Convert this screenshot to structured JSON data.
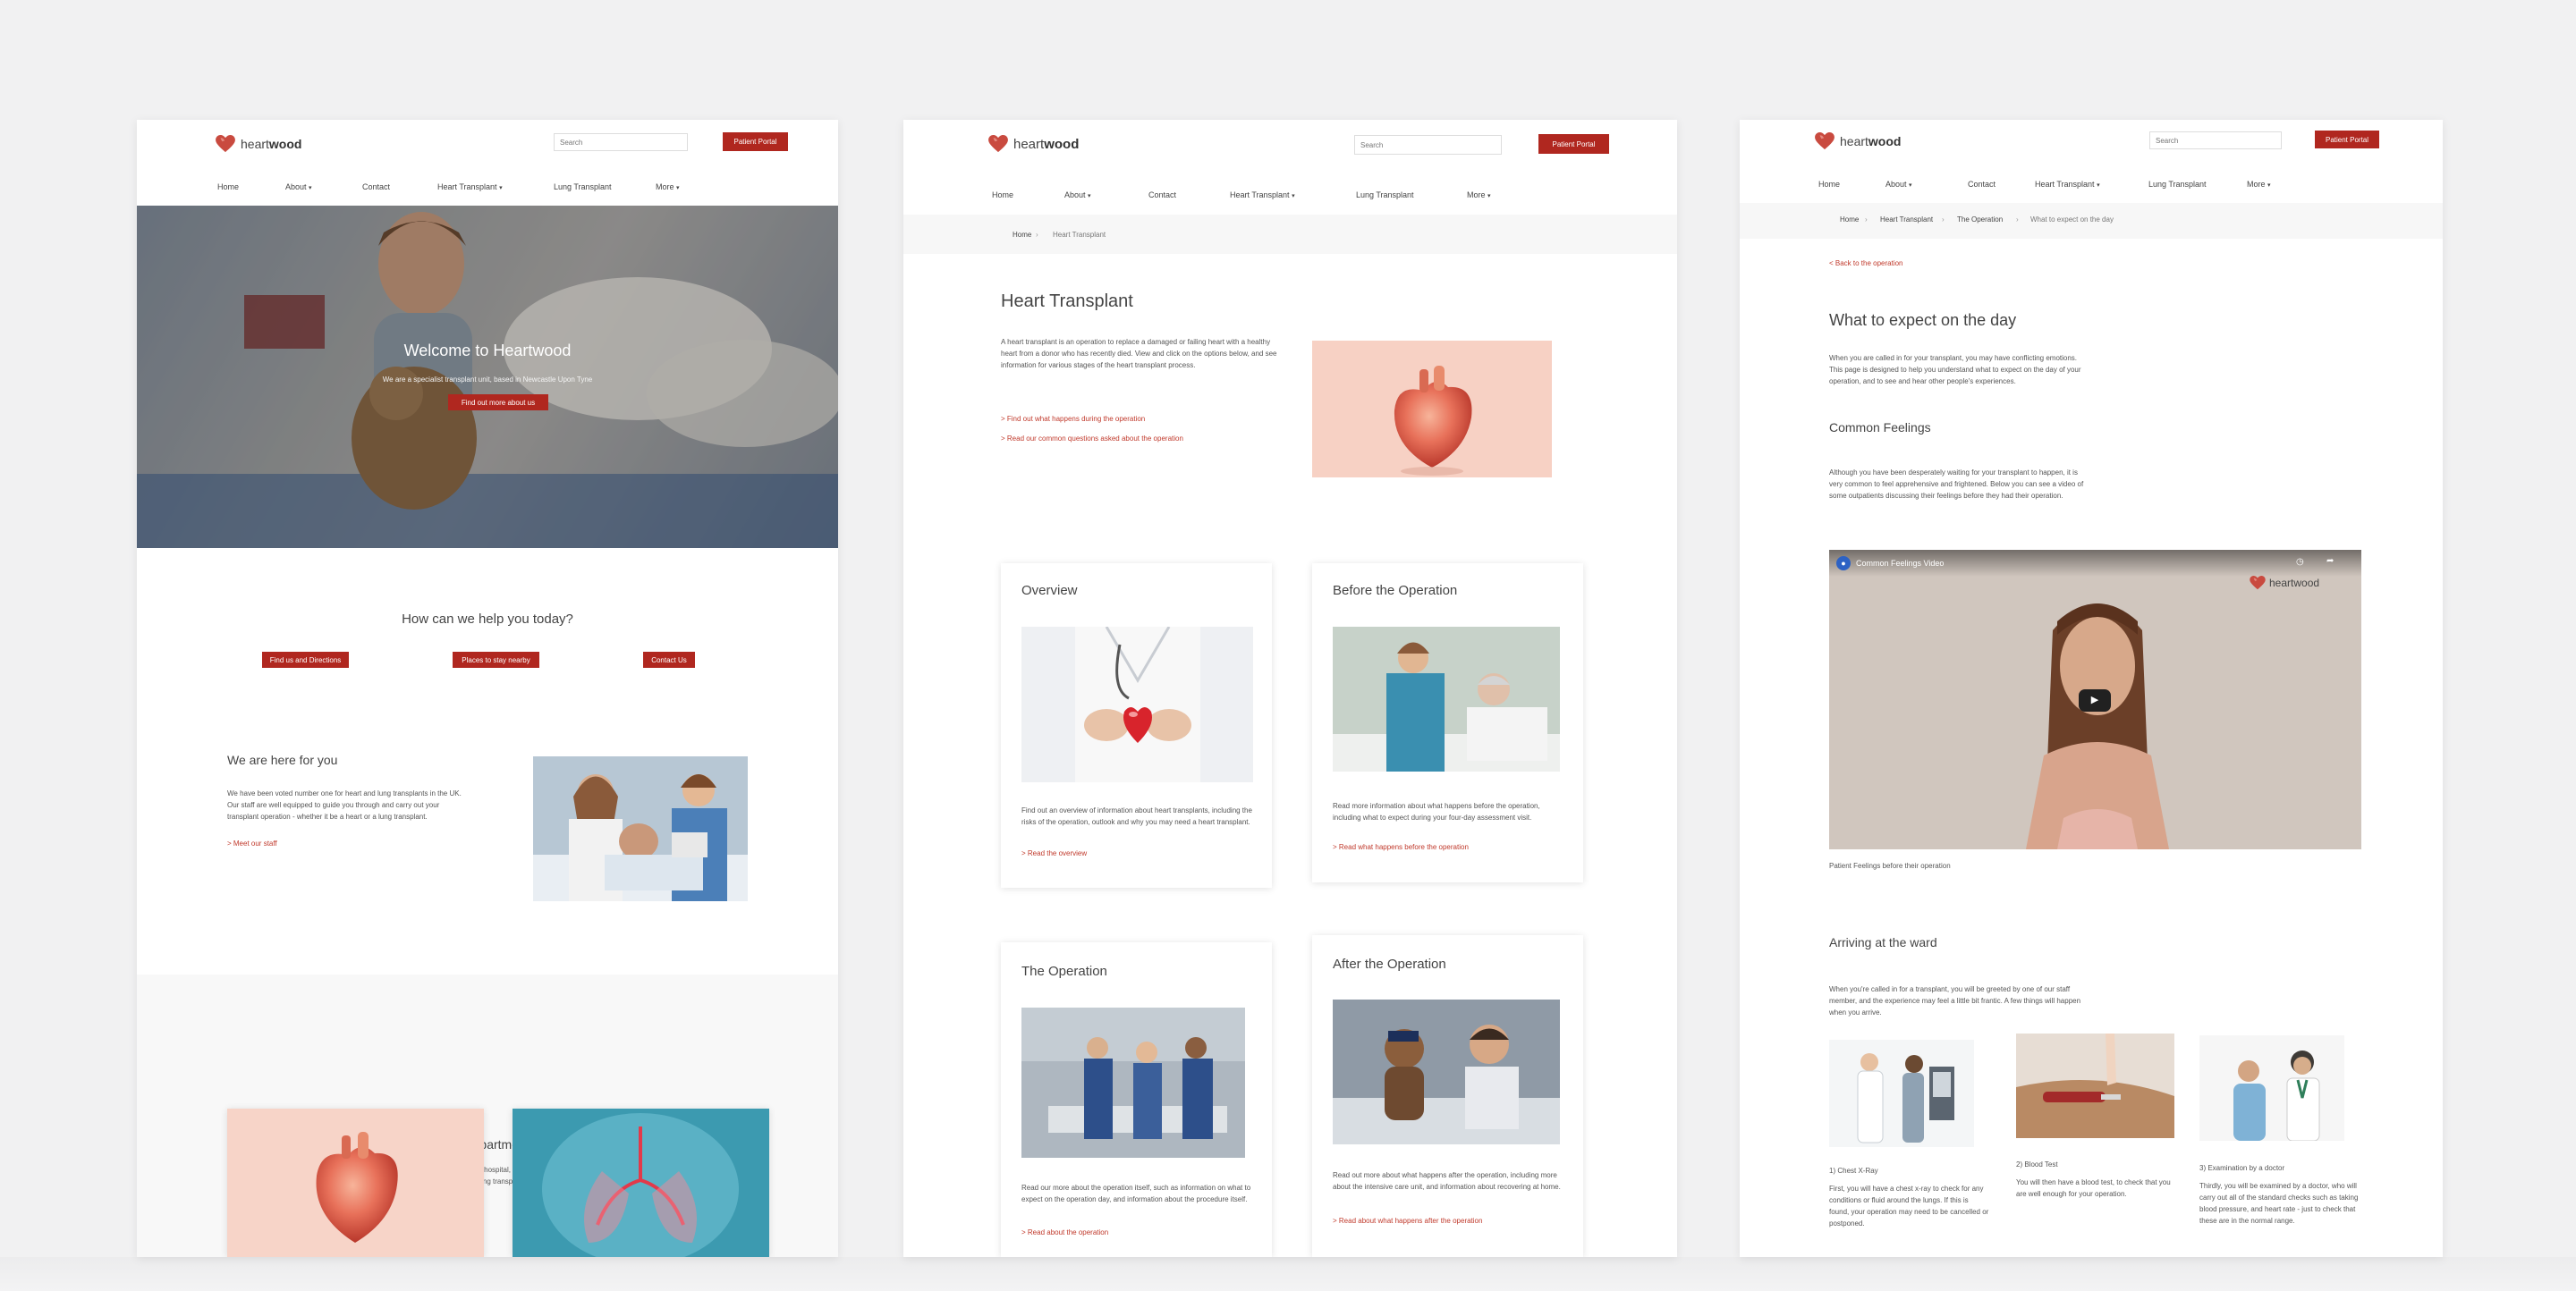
{
  "common": {
    "brand_light": "heart",
    "brand_bold": "wood",
    "search_placeholder": "Search",
    "patient_portal": "Patient Portal",
    "nav": [
      "Home",
      "About",
      "Contact",
      "Heart Transplant",
      "Lung Transplant",
      "More"
    ]
  },
  "home": {
    "hero_title": "Welcome to Heartwood",
    "hero_subtitle": "We are a specialist transplant unit, based in Newcastle Upon Tyne",
    "hero_button": "Find out more about us",
    "help_title": "How can we help you today?",
    "help_buttons": [
      "Find us and Directions",
      "Places to stay nearby",
      "Contact Us"
    ],
    "here_title": "We are here for you",
    "here_text": "We have been voted number one for heart and lung transplants in the UK. Our staff are well equipped to guide you through and carry out your transplant operation - whether it be a heart or a lung transplant.",
    "here_link": "> Meet our staff",
    "dept_title": "Our Departments",
    "dept_text": "We are a specialist transplant hospital, specifically carrying out heart and lung transplants."
  },
  "heart": {
    "breadcrumb": [
      "Home",
      "Heart Transplant"
    ],
    "title": "Heart Transplant",
    "intro": "A heart transplant is an operation to replace a damaged or failing heart with a healthy heart from a donor who has recently died. View and click on the options below, and see information for various stages of the heart transplant process.",
    "link1": "> Find out what happens during the operation",
    "link2": "> Read our common questions asked about the operation",
    "cards": [
      {
        "title": "Overview",
        "text": "Find out an overview of information about heart transplants, including the risks of the operation, outlook and why you may need a heart transplant.",
        "link": "> Read the overview"
      },
      {
        "title": "Before the Operation",
        "text": "Read more information about what happens before the operation, including what to expect during your four-day assessment visit.",
        "link": "> Read what happens before the operation"
      },
      {
        "title": "The Operation",
        "text": "Read our more about the operation itself, such as information on what to expect on the operation day, and information about the procedure itself.",
        "link": "> Read about the operation"
      },
      {
        "title": "After the Operation",
        "text": "Read out more about what happens after the operation, including more about the intensive care unit, and information about recovering at home.",
        "link": "> Read about what happens after the operation"
      }
    ]
  },
  "day": {
    "breadcrumb": [
      "Home",
      "Heart Transplant",
      "The Operation",
      "What to expect on the day"
    ],
    "back_link": "< Back to the operation",
    "title": "What to expect on the day",
    "intro": "When you are called in for your transplant, you may have conflicting emotions. This page is designed to help you understand what to expect on the day of your operation, and to see and hear other people's experiences.",
    "feelings_title": "Common Feelings",
    "feelings_text": "Although you have been desperately waiting for your transplant to happen, it is very common to feel apprehensive and frightened. Below you can see a video of some outpatients discussing their feelings before they had their operation.",
    "video_title": "Common Feelings Video",
    "video_caption": "Patient Feelings before their operation",
    "arriving_title": "Arriving at the ward",
    "arriving_text": "When you're called in for a transplant, you will be greeted by one of our staff member, and the experience may feel a little bit frantic. A few things will happen when you arrive.",
    "steps": [
      {
        "label": "1) Chest X-Ray",
        "text": "First, you will have a chest x-ray to check for any conditions or fluid around the lungs. If this is found, your operation may need to be cancelled or postponed."
      },
      {
        "label": "2) Blood Test",
        "text": "You will then have a blood test, to check that you are well enough for your operation."
      },
      {
        "label": "3) Examination by a doctor",
        "text": "Thirdly, you will be examined by a doctor, who will carry out all of the standard checks such as taking blood pressure, and heart rate - just to check that these are in the normal range."
      }
    ]
  }
}
